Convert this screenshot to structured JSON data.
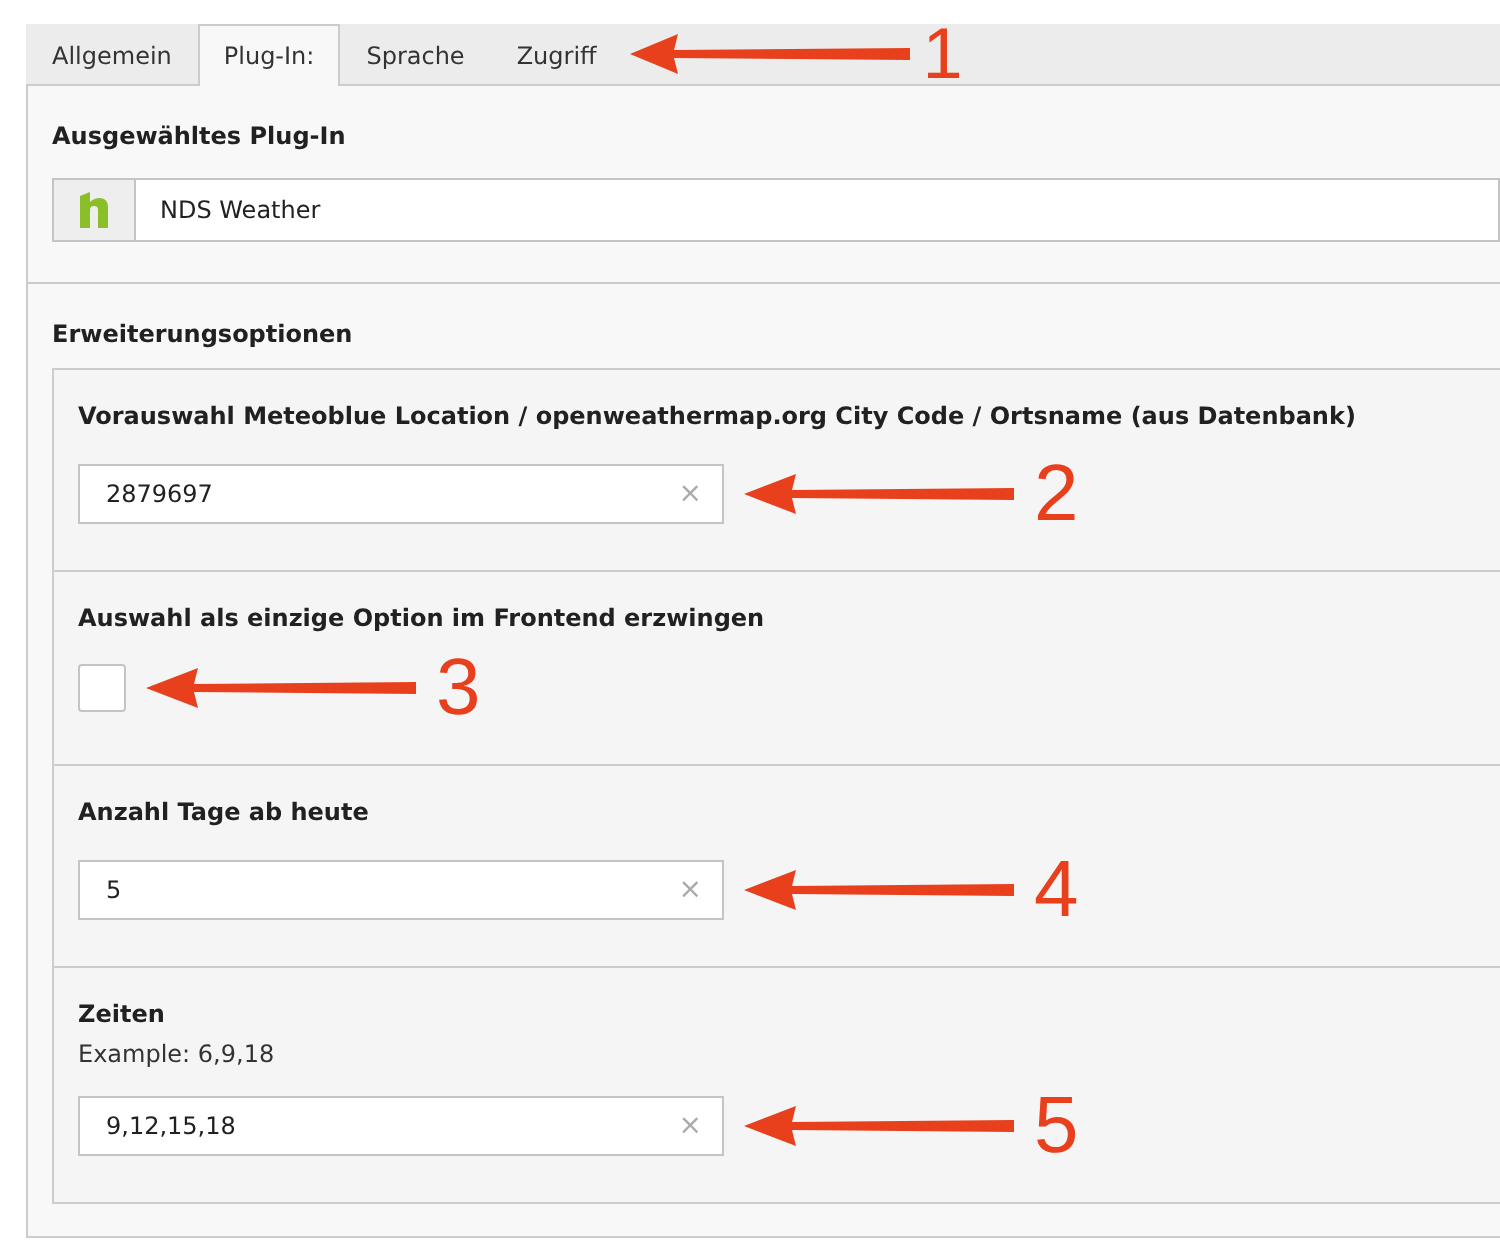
{
  "tabs": [
    {
      "label": "Allgemein",
      "selected": false
    },
    {
      "label": "Plug-In:",
      "selected": true
    },
    {
      "label": "Sprache",
      "selected": false
    },
    {
      "label": "Zugriff",
      "selected": false
    }
  ],
  "tab_annotation": {
    "label": "1"
  },
  "plugin_section": {
    "heading": "Ausgewähltes Plug-In",
    "plugin_name": "NDS Weather"
  },
  "options_section": {
    "heading": "Erweiterungsoptionen",
    "fields": [
      {
        "kind": "text",
        "label": "Vorauswahl Meteoblue Location / openweathermap.org City Code / Ortsname (aus Datenbank)",
        "value": "2879697",
        "clear": "×",
        "annotation": "2"
      },
      {
        "kind": "checkbox",
        "label": "Auswahl als einzige Option im Frontend erzwingen",
        "checked": false,
        "annotation": "3"
      },
      {
        "kind": "text",
        "label": "Anzahl Tage ab heute",
        "value": "5",
        "clear": "×",
        "annotation": "4"
      },
      {
        "kind": "text",
        "label": "Zeiten",
        "description": "Example: 6,9,18",
        "value": "9,12,15,18",
        "clear": "×",
        "annotation": "5"
      }
    ]
  }
}
